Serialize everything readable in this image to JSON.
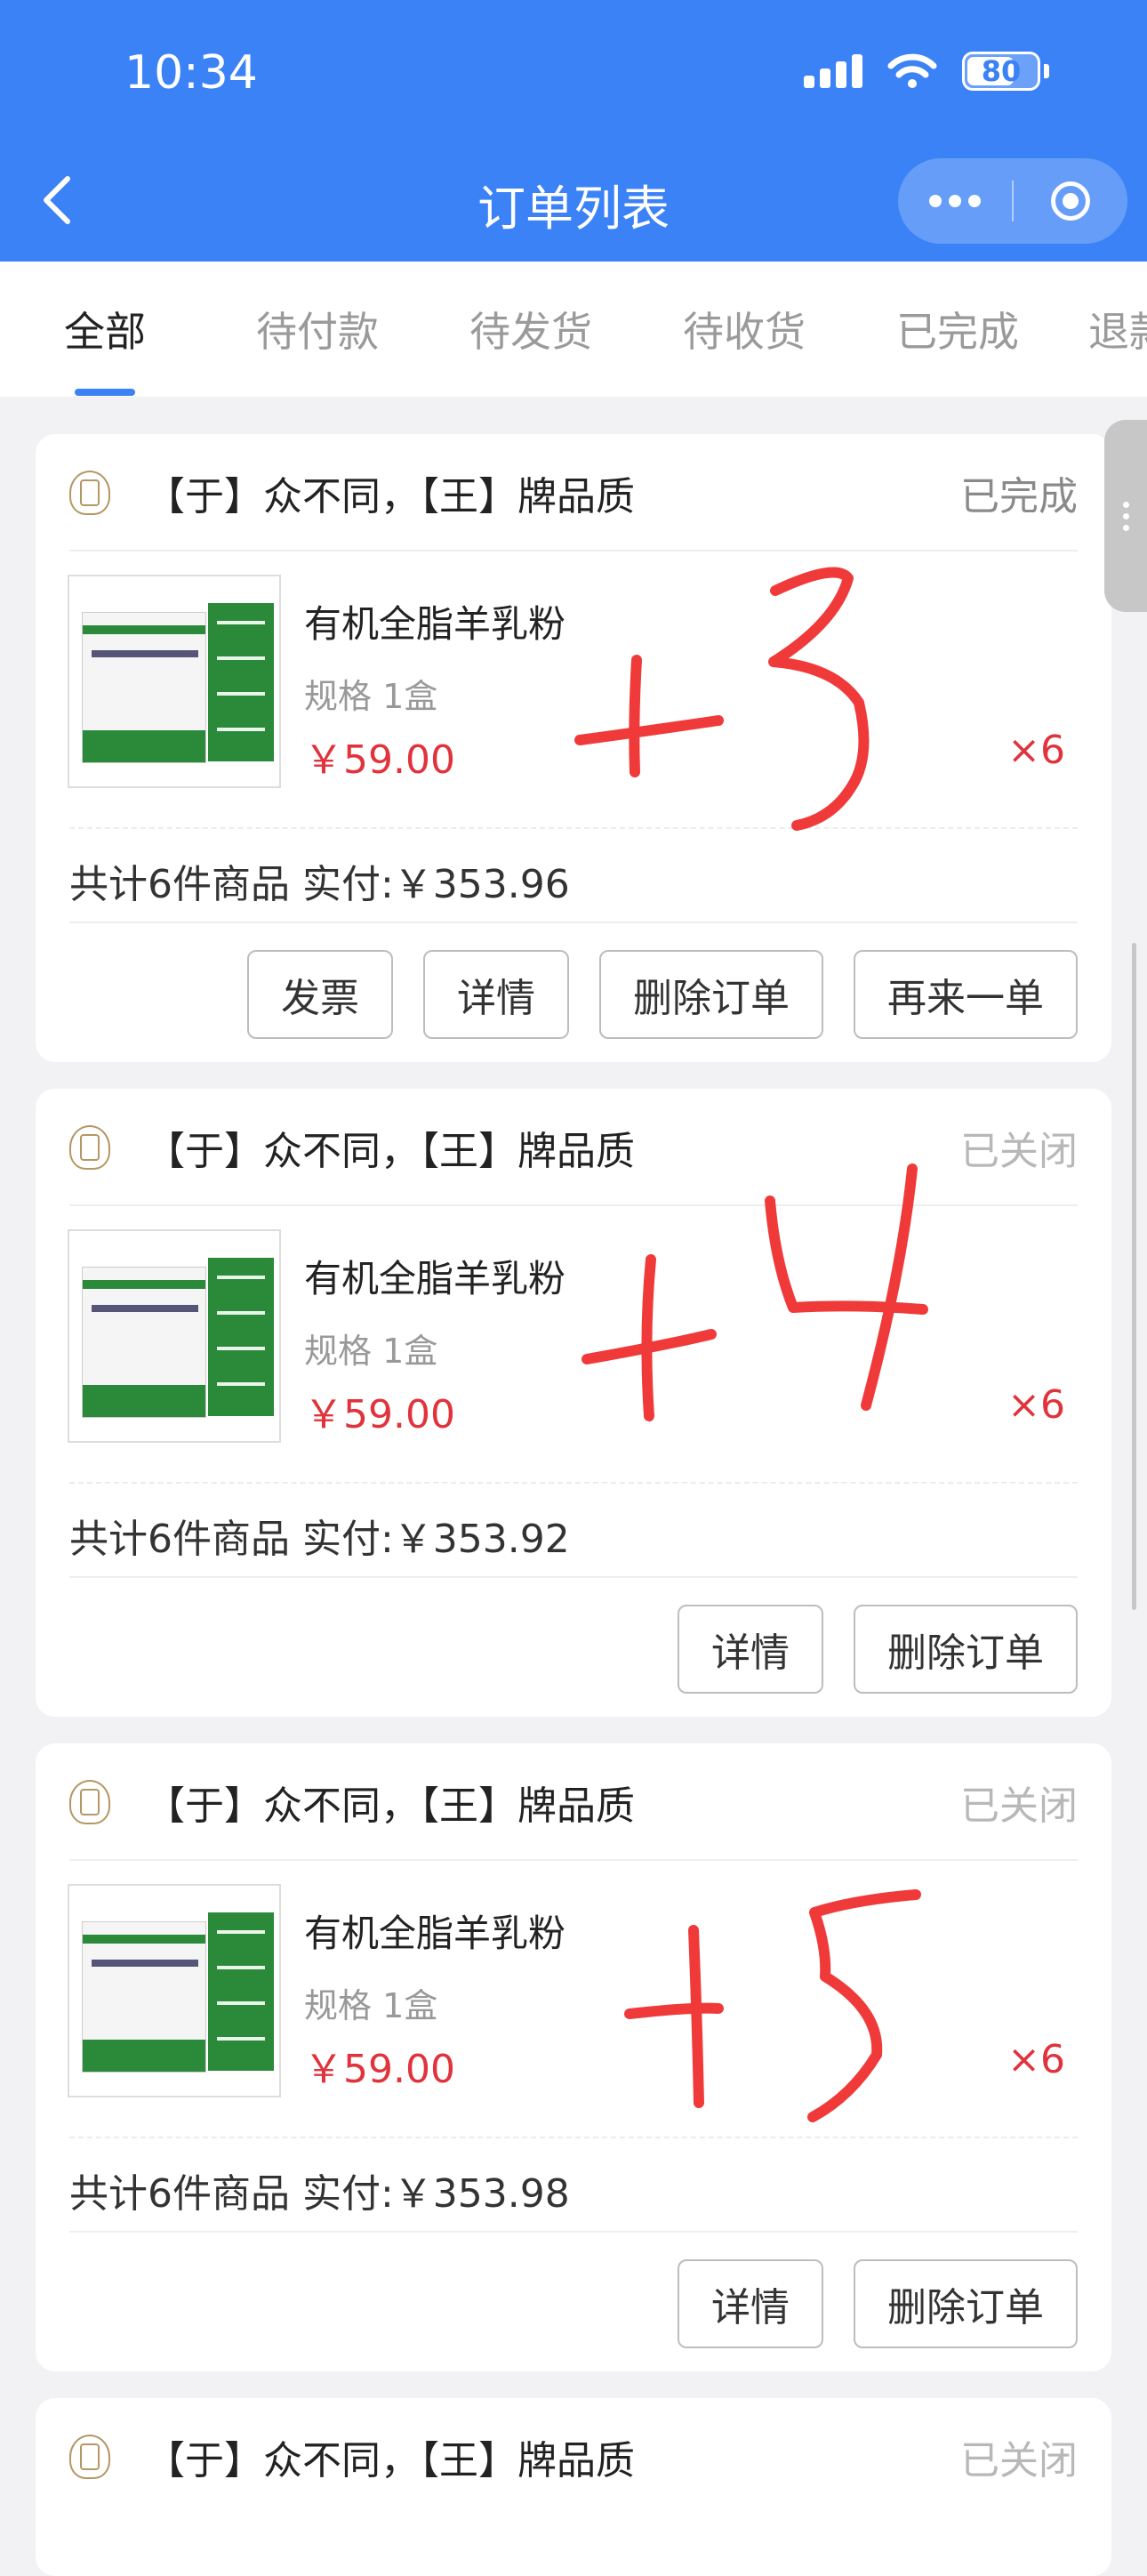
{
  "status_bar": {
    "time": "10:34",
    "battery": "80"
  },
  "nav": {
    "title": "订单列表",
    "back_icon": "chevron-left-icon"
  },
  "tabs": [
    {
      "label": "全部",
      "active": true
    },
    {
      "label": "待付款",
      "active": false
    },
    {
      "label": "待发货",
      "active": false
    },
    {
      "label": "待收货",
      "active": false
    },
    {
      "label": "已完成",
      "active": false
    },
    {
      "label": "退款",
      "active": false
    }
  ],
  "orders": [
    {
      "shop": "【于】众不同，【王】牌品质",
      "status": "已完成",
      "product": {
        "name": "有机全脂羊乳粉",
        "spec": "规格 1盒",
        "price": "￥59.00",
        "qty": "×6"
      },
      "total": "共计6件商品 实付:￥353.96",
      "buttons": [
        "发票",
        "详情",
        "删除订单",
        "再来一单"
      ],
      "annotation": "+3"
    },
    {
      "shop": "【于】众不同，【王】牌品质",
      "status": "已关闭",
      "product": {
        "name": "有机全脂羊乳粉",
        "spec": "规格 1盒",
        "price": "￥59.00",
        "qty": "×6"
      },
      "total": "共计6件商品 实付:￥353.92",
      "buttons": [
        "详情",
        "删除订单"
      ],
      "annotation": "+4"
    },
    {
      "shop": "【于】众不同，【王】牌品质",
      "status": "已关闭",
      "product": {
        "name": "有机全脂羊乳粉",
        "spec": "规格 1盒",
        "price": "￥59.00",
        "qty": "×6"
      },
      "total": "共计6件商品 实付:￥353.98",
      "buttons": [
        "详情",
        "删除订单"
      ],
      "annotation": "+5"
    },
    {
      "shop": "【于】众不同，【王】牌品质",
      "status": "已关闭"
    }
  ],
  "colors": {
    "header": "#3b82f6",
    "price": "#e0333c",
    "annotation": "#f03a3a"
  }
}
